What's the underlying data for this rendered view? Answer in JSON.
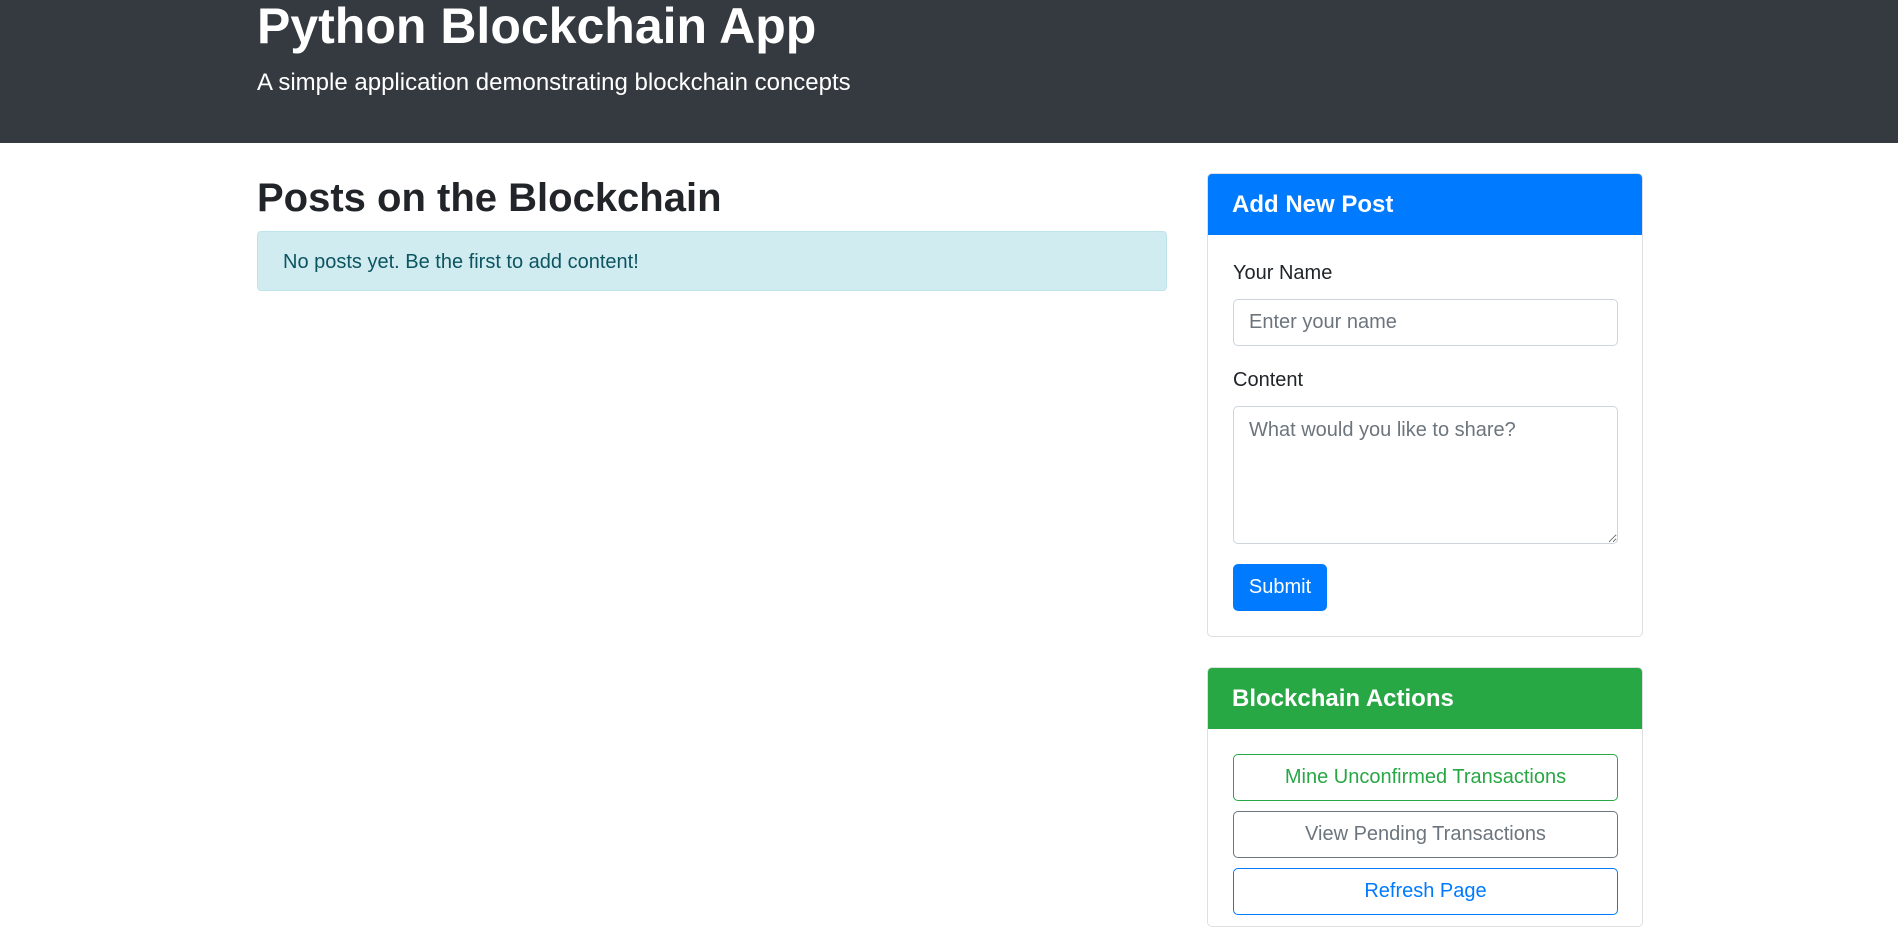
{
  "header": {
    "title": "Python Blockchain App",
    "subtitle": "A simple application demonstrating blockchain concepts"
  },
  "posts": {
    "heading": "Posts on the Blockchain",
    "empty_message": "No posts yet. Be the first to add content!"
  },
  "add_post": {
    "title": "Add New Post",
    "name_label": "Your Name",
    "name_placeholder": "Enter your name",
    "name_value": "",
    "content_label": "Content",
    "content_placeholder": "What would you like to share?",
    "content_value": "",
    "submit_label": "Submit"
  },
  "actions": {
    "title": "Blockchain Actions",
    "mine_label": "Mine Unconfirmed Transactions",
    "pending_label": "View Pending Transactions",
    "refresh_label": "Refresh Page"
  },
  "colors": {
    "header_bg": "#343a40",
    "primary": "#007bff",
    "success": "#28a745",
    "secondary": "#6c757d",
    "info_bg": "#d1ecf1",
    "info_text": "#0c5460"
  }
}
